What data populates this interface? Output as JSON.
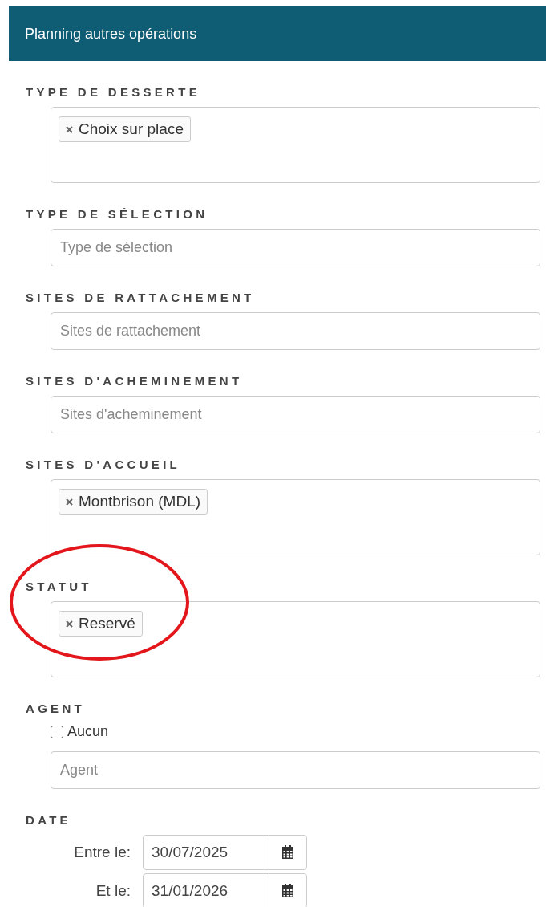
{
  "header": {
    "title": "Planning autres opérations"
  },
  "sections": [
    {
      "kind": "multiselect",
      "label": "TYPE DE DESSERTE",
      "tags": [
        "Choix sur place"
      ]
    },
    {
      "kind": "select",
      "label": "TYPE DE SÉLECTION",
      "placeholder": "Type de sélection"
    },
    {
      "kind": "select",
      "label": "SITES DE RATTACHEMENT",
      "placeholder": "Sites de rattachement"
    },
    {
      "kind": "select",
      "label": "SITES D'ACHEMINEMENT",
      "placeholder": "Sites d'acheminement"
    },
    {
      "kind": "multiselect",
      "label": "SITES D'ACCUEIL",
      "tags": [
        "Montbrison (MDL)"
      ]
    },
    {
      "kind": "multiselect",
      "label": "STATUT",
      "tags": [
        "Reservé"
      ],
      "highlighted": true
    },
    {
      "kind": "agent",
      "label": "AGENT",
      "checkbox": {
        "label": "Aucun",
        "checked": false
      },
      "placeholder": "Agent"
    },
    {
      "kind": "daterange",
      "label": "DATE",
      "rows": [
        {
          "label": "Entre le:",
          "value": "30/07/2025"
        },
        {
          "label": "Et le:",
          "value": "31/01/2026"
        }
      ]
    }
  ]
}
